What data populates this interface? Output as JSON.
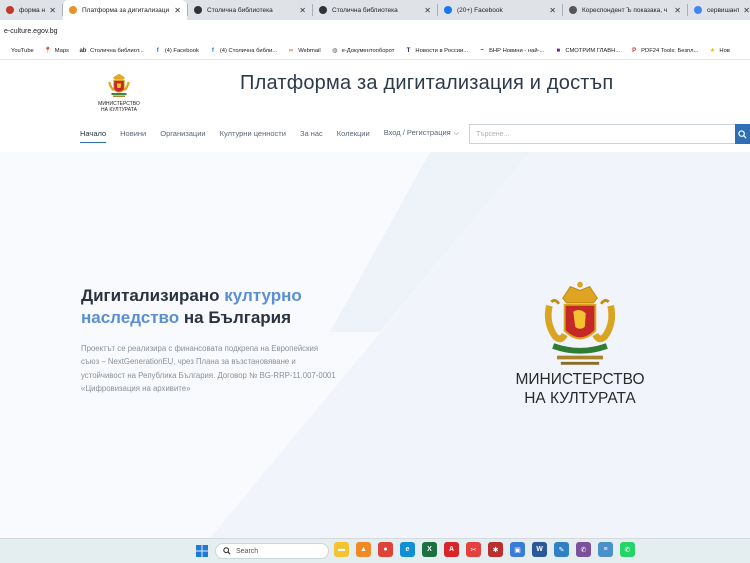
{
  "browser": {
    "tabs": [
      {
        "label": "форма на МК - ...",
        "icon": "ministry-icon",
        "color": "#c0392b",
        "width": 62,
        "active": false
      },
      {
        "label": "Платформа за дигитализаци",
        "icon": "platform-icon",
        "color": "#e8922b",
        "width": 124,
        "active": true
      },
      {
        "label": "Столична библиотека",
        "icon": "library-icon",
        "color": "#333333",
        "width": 124,
        "active": false
      },
      {
        "label": "Столична библиотека",
        "icon": "library-icon",
        "color": "#333333",
        "width": 124,
        "active": false
      },
      {
        "label": "(20+) Facebook",
        "icon": "facebook-icon",
        "color": "#1877f2",
        "width": 124,
        "active": false
      },
      {
        "label": "Кореспондент Ъ показака, ч",
        "icon": "news-icon",
        "color": "#555555",
        "width": 124,
        "active": false
      },
      {
        "label": "сервишант - Goo",
        "icon": "google-icon",
        "color": "#4285f4",
        "width": 68,
        "active": false
      }
    ],
    "close_glyph": "✕",
    "url": "e-culture.egov.bg",
    "bookmarks": [
      {
        "label": "YouTube",
        "icon": "youtube-icon",
        "color": "#ff0000",
        "glyph": ""
      },
      {
        "label": "Maps",
        "icon": "maps-icon",
        "color": "#34a853",
        "glyph": "📍"
      },
      {
        "label": "Столична библиот...",
        "icon": "library-icon",
        "color": "#333333",
        "glyph": "ab"
      },
      {
        "label": "(4) Facebook",
        "icon": "facebook-icon",
        "color": "#1877f2",
        "glyph": "f"
      },
      {
        "label": "(4) Столична библи...",
        "icon": "facebook-icon",
        "color": "#1877f2",
        "glyph": "f"
      },
      {
        "label": "Webmail",
        "icon": "webmail-icon",
        "color": "#f06a35",
        "glyph": "∞"
      },
      {
        "label": "е-Документооборот",
        "icon": "globe-icon",
        "color": "#555555",
        "glyph": "◍"
      },
      {
        "label": "Новости в России...",
        "icon": "news-t-icon",
        "color": "#1a237e",
        "glyph": "T"
      },
      {
        "label": "БНР Новини - най-...",
        "icon": "bnr-icon",
        "color": "#333333",
        "glyph": "~"
      },
      {
        "label": "СМОТРИМ ГЛАВН...",
        "icon": "smotrim-icon",
        "color": "#6a1b9a",
        "glyph": "■"
      },
      {
        "label": "PDF24 Tools: Безпл...",
        "icon": "pdf24-icon",
        "color": "#d32f2f",
        "glyph": "P"
      },
      {
        "label": "Hoв",
        "icon": "star-icon",
        "color": "#f2b600",
        "glyph": "★"
      }
    ]
  },
  "site": {
    "logo_text_line1": "МИНИСТЕРСТВО",
    "logo_text_line2": "НА КУЛТУРАТА",
    "title": "Платформа за дигитализация и достъп",
    "nav": {
      "home": "Начало",
      "news": "Новини",
      "orgs": "Организации",
      "cultural": "Културни ценности",
      "about": "За нас",
      "collections": "Колекции",
      "login": "Вход / Регистрация",
      "chevron": "⌵"
    },
    "search_placeholder": "Търсене..."
  },
  "hero": {
    "title_part1": "Дигитализирано ",
    "title_hl1": "културно наследство",
    "title_part2": " на България",
    "text": "Проектът се реализира с финансовата подкрепа на Европейския съюз – NextGenerationEU, чрез Плана за възстановяване и устойчивост на Република България. Договор № BG-RRP-11.007-0001 «Цифровизация на архивите»",
    "emblem_line1": "МИНИСТЕРСТВО",
    "emblem_line2": "НА КУЛТУРАТА"
  },
  "taskbar": {
    "search_label": "Search",
    "apps": [
      {
        "name": "file-explorer-icon",
        "color": "#f4c430",
        "glyph": "▬"
      },
      {
        "name": "vlc-icon",
        "color": "#f08a24",
        "glyph": "▲"
      },
      {
        "name": "chrome-icon",
        "color": "#db4437",
        "glyph": "●"
      },
      {
        "name": "edge-icon",
        "color": "#0f8fd6",
        "glyph": "e"
      },
      {
        "name": "excel-icon",
        "color": "#1d6f42",
        "glyph": "X"
      },
      {
        "name": "acrobat-icon",
        "color": "#d9252a",
        "glyph": "A"
      },
      {
        "name": "snipping-icon",
        "color": "#e3413b",
        "glyph": "✂"
      },
      {
        "name": "app-puzzle-icon",
        "color": "#b8312f",
        "glyph": "✱"
      },
      {
        "name": "photos-icon",
        "color": "#3a7bd5",
        "glyph": "▣"
      },
      {
        "name": "word-icon",
        "color": "#2b579a",
        "glyph": "W"
      },
      {
        "name": "paint-icon",
        "color": "#2f80c4",
        "glyph": "✎"
      },
      {
        "name": "viber-icon",
        "color": "#7b519d",
        "glyph": "✆"
      },
      {
        "name": "notepad-icon",
        "color": "#4a90c9",
        "glyph": "≡"
      },
      {
        "name": "whatsapp-icon",
        "color": "#25d366",
        "glyph": "✆"
      }
    ]
  }
}
